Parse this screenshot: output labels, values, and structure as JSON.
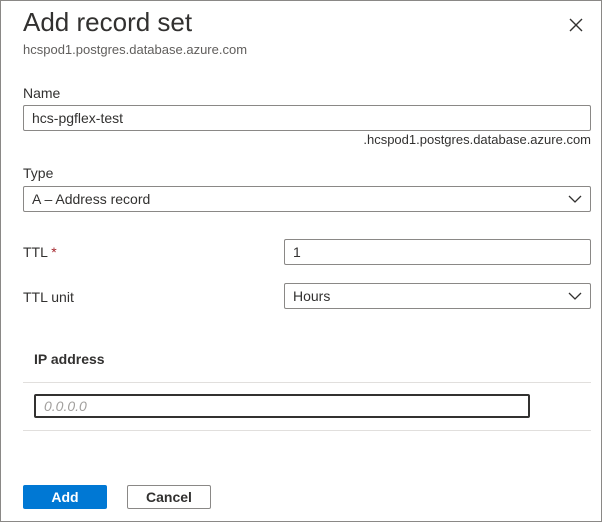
{
  "header": {
    "title": "Add record set",
    "subtitle": "hcspod1.postgres.database.azure.com",
    "close_icon": "close-icon"
  },
  "form": {
    "name": {
      "label": "Name",
      "value": "hcs-pgflex-test",
      "suffix": ".hcspod1.postgres.database.azure.com"
    },
    "type": {
      "label": "Type",
      "value": "A – Address record"
    },
    "ttl": {
      "label": "TTL",
      "required_marker": "*",
      "value": "1"
    },
    "ttl_unit": {
      "label": "TTL unit",
      "value": "Hours"
    },
    "ip": {
      "header": "IP address",
      "placeholder": "0.0.0.0",
      "value": ""
    }
  },
  "footer": {
    "add_label": "Add",
    "cancel_label": "Cancel"
  },
  "colors": {
    "primary": "#0078d4",
    "required": "#a4262c"
  }
}
